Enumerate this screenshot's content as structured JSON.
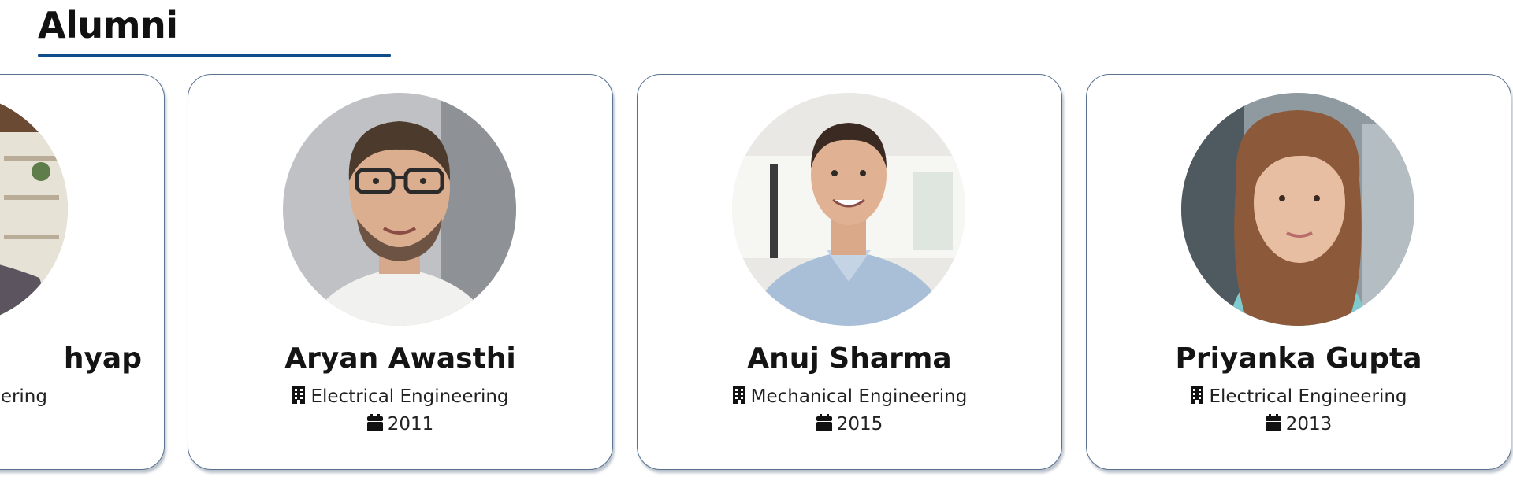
{
  "section": {
    "title": "Alumni",
    "accent_color": "#0e4c8c"
  },
  "alumni": [
    {
      "name": "Kashyap",
      "name_visible": "hyap",
      "department_visible": "ering",
      "year": ""
    },
    {
      "name": "Aryan Awasthi",
      "department": "Electrical Engineering",
      "year": "2011"
    },
    {
      "name": "Anuj Sharma",
      "department": "Mechanical Engineering",
      "year": "2015"
    },
    {
      "name": "Priyanka Gupta",
      "department": "Electrical Engineering",
      "year": "2013"
    }
  ],
  "icons": {
    "department": "building-icon",
    "year": "calendar-icon"
  }
}
